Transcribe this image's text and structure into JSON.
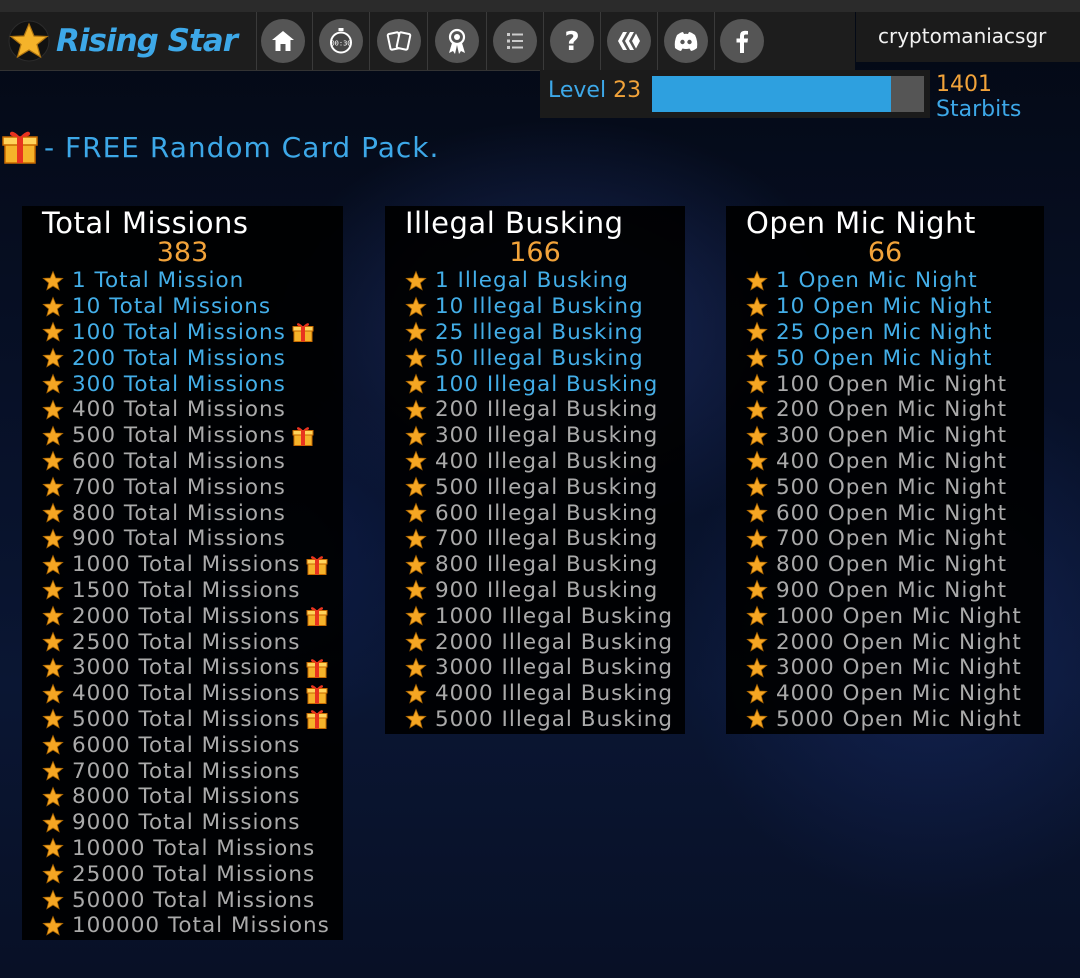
{
  "app": {
    "name": "Rising Star"
  },
  "nav": {
    "icons": [
      "home-icon",
      "stopwatch-icon",
      "cards-icon",
      "award-icon",
      "list-icon",
      "help-icon",
      "hive-icon",
      "discord-icon",
      "facebook-icon"
    ],
    "timer_text": "00:30"
  },
  "user": {
    "name": "cryptomaniacsgr"
  },
  "level": {
    "label": "Level",
    "value": "23",
    "progress": 0.88
  },
  "starbits": {
    "value": "1401",
    "label": "Starbits"
  },
  "colors": {
    "accent": "#3da8e8",
    "orange": "#f2a33a",
    "completed": "#43aee8",
    "pending": "#aaaaaa"
  },
  "free_pack": {
    "text": "- FREE Random Card Pack."
  },
  "panels": [
    {
      "title": "Total Missions",
      "count": "383",
      "items": [
        {
          "label": "1 Total Mission",
          "done": true,
          "gift": false
        },
        {
          "label": "10 Total Missions",
          "done": true,
          "gift": false
        },
        {
          "label": "100 Total Missions",
          "done": true,
          "gift": true
        },
        {
          "label": "200 Total Missions",
          "done": true,
          "gift": false
        },
        {
          "label": "300 Total Missions",
          "done": true,
          "gift": false
        },
        {
          "label": "400 Total Missions",
          "done": false,
          "gift": false
        },
        {
          "label": "500 Total Missions",
          "done": false,
          "gift": true
        },
        {
          "label": "600 Total Missions",
          "done": false,
          "gift": false
        },
        {
          "label": "700 Total Missions",
          "done": false,
          "gift": false
        },
        {
          "label": "800 Total Missions",
          "done": false,
          "gift": false
        },
        {
          "label": "900 Total Missions",
          "done": false,
          "gift": false
        },
        {
          "label": "1000 Total Missions",
          "done": false,
          "gift": true
        },
        {
          "label": "1500 Total Missions",
          "done": false,
          "gift": false
        },
        {
          "label": "2000 Total Missions",
          "done": false,
          "gift": true
        },
        {
          "label": "2500 Total Missions",
          "done": false,
          "gift": false
        },
        {
          "label": "3000 Total Missions",
          "done": false,
          "gift": true
        },
        {
          "label": "4000 Total Missions",
          "done": false,
          "gift": true
        },
        {
          "label": "5000 Total Missions",
          "done": false,
          "gift": true
        },
        {
          "label": "6000 Total Missions",
          "done": false,
          "gift": false
        },
        {
          "label": "7000 Total Missions",
          "done": false,
          "gift": false
        },
        {
          "label": "8000 Total Missions",
          "done": false,
          "gift": false
        },
        {
          "label": "9000 Total Missions",
          "done": false,
          "gift": false
        },
        {
          "label": "10000 Total Missions",
          "done": false,
          "gift": false
        },
        {
          "label": "25000 Total Missions",
          "done": false,
          "gift": false
        },
        {
          "label": "50000 Total Missions",
          "done": false,
          "gift": false
        },
        {
          "label": "100000 Total Missions",
          "done": false,
          "gift": false
        }
      ]
    },
    {
      "title": "Illegal Busking",
      "count": "166",
      "items": [
        {
          "label": "1 Illegal Busking",
          "done": true,
          "gift": false
        },
        {
          "label": "10 Illegal Busking",
          "done": true,
          "gift": false
        },
        {
          "label": "25 Illegal Busking",
          "done": true,
          "gift": false
        },
        {
          "label": "50 Illegal Busking",
          "done": true,
          "gift": false
        },
        {
          "label": "100 Illegal Busking",
          "done": true,
          "gift": false
        },
        {
          "label": "200 Illegal Busking",
          "done": false,
          "gift": false
        },
        {
          "label": "300 Illegal Busking",
          "done": false,
          "gift": false
        },
        {
          "label": "400 Illegal Busking",
          "done": false,
          "gift": false
        },
        {
          "label": "500 Illegal Busking",
          "done": false,
          "gift": false
        },
        {
          "label": "600 Illegal Busking",
          "done": false,
          "gift": false
        },
        {
          "label": "700 Illegal Busking",
          "done": false,
          "gift": false
        },
        {
          "label": "800 Illegal Busking",
          "done": false,
          "gift": false
        },
        {
          "label": "900 Illegal Busking",
          "done": false,
          "gift": false
        },
        {
          "label": "1000 Illegal Busking",
          "done": false,
          "gift": false
        },
        {
          "label": "2000 Illegal Busking",
          "done": false,
          "gift": false
        },
        {
          "label": "3000 Illegal Busking",
          "done": false,
          "gift": false
        },
        {
          "label": "4000 Illegal Busking",
          "done": false,
          "gift": false
        },
        {
          "label": "5000 Illegal Busking",
          "done": false,
          "gift": false
        }
      ]
    },
    {
      "title": "Open Mic Night",
      "count": "66",
      "items": [
        {
          "label": "1 Open Mic Night",
          "done": true,
          "gift": false
        },
        {
          "label": "10 Open Mic Night",
          "done": true,
          "gift": false
        },
        {
          "label": "25 Open Mic Night",
          "done": true,
          "gift": false
        },
        {
          "label": "50 Open Mic Night",
          "done": true,
          "gift": false
        },
        {
          "label": "100 Open Mic Night",
          "done": false,
          "gift": false
        },
        {
          "label": "200 Open Mic Night",
          "done": false,
          "gift": false
        },
        {
          "label": "300 Open Mic Night",
          "done": false,
          "gift": false
        },
        {
          "label": "400 Open Mic Night",
          "done": false,
          "gift": false
        },
        {
          "label": "500 Open Mic Night",
          "done": false,
          "gift": false
        },
        {
          "label": "600 Open Mic Night",
          "done": false,
          "gift": false
        },
        {
          "label": "700 Open Mic Night",
          "done": false,
          "gift": false
        },
        {
          "label": "800 Open Mic Night",
          "done": false,
          "gift": false
        },
        {
          "label": "900 Open Mic Night",
          "done": false,
          "gift": false
        },
        {
          "label": "1000 Open Mic Night",
          "done": false,
          "gift": false
        },
        {
          "label": "2000 Open Mic Night",
          "done": false,
          "gift": false
        },
        {
          "label": "3000 Open Mic Night",
          "done": false,
          "gift": false
        },
        {
          "label": "4000 Open Mic Night",
          "done": false,
          "gift": false
        },
        {
          "label": "5000 Open Mic Night",
          "done": false,
          "gift": false
        }
      ]
    }
  ]
}
